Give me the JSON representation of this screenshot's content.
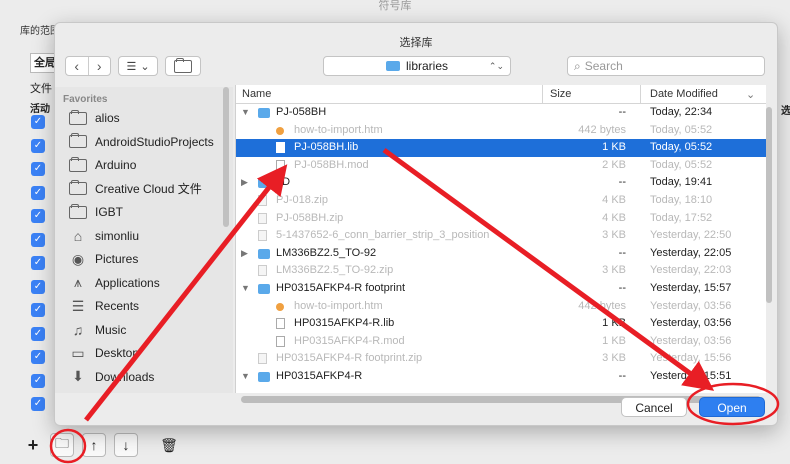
{
  "background": {
    "window_title": "符号库",
    "scope_label": "库的范围",
    "segment_label": "全局",
    "file_label": "文件",
    "active_header": "活动",
    "right_header": "选",
    "checkbox_glyph": "✓",
    "checked_rows": 13
  },
  "bottom_bar": {
    "add_glyph": "+",
    "folder_glyph": "🗀",
    "up_glyph": "↑",
    "down_glyph": "↓",
    "trash_glyph": "🗑"
  },
  "dialog": {
    "title": "选择库",
    "back_glyph": "‹",
    "forward_glyph": "›",
    "view_glyph": "☰",
    "view_caret": "⌄",
    "location": "libraries",
    "location_arrows": "⌃⌄",
    "search_placeholder": "Search",
    "cancel_label": "Cancel",
    "open_label": "Open"
  },
  "sidebar": {
    "header": "Favorites",
    "items": [
      {
        "label": "alios",
        "icon": "folder-icon"
      },
      {
        "label": "AndroidStudioProjects",
        "icon": "folder-icon"
      },
      {
        "label": "Arduino",
        "icon": "folder-icon"
      },
      {
        "label": "Creative Cloud 文件",
        "icon": "folder-icon"
      },
      {
        "label": "IGBT",
        "icon": "folder-icon"
      },
      {
        "label": "simonliu",
        "icon": "home-icon",
        "glyph": "⌂"
      },
      {
        "label": "Pictures",
        "icon": "camera-icon",
        "glyph": "◉"
      },
      {
        "label": "Applications",
        "icon": "applications-icon",
        "glyph": "⩚"
      },
      {
        "label": "Recents",
        "icon": "recents-icon",
        "glyph": "☰"
      },
      {
        "label": "Music",
        "icon": "music-icon",
        "glyph": "♫"
      },
      {
        "label": "Desktop",
        "icon": "desktop-icon",
        "glyph": "▭"
      },
      {
        "label": "Downloads",
        "icon": "downloads-icon",
        "glyph": "⬇"
      }
    ]
  },
  "file_list": {
    "columns": {
      "name": "Name",
      "size": "Size",
      "date": "Date Modified",
      "date_caret": "⌄"
    },
    "rows": [
      {
        "name": "PJ-058BH",
        "size": "--",
        "date": "Today, 22:34",
        "kind": "folder",
        "disc": "▼",
        "indent": 0,
        "state": "normal"
      },
      {
        "name": "how-to-import.htm",
        "size": "442 bytes",
        "date": "Today, 05:52",
        "kind": "web",
        "disc": "",
        "indent": 1,
        "state": "dim"
      },
      {
        "name": "PJ-058BH.lib",
        "size": "1 KB",
        "date": "Today, 05:52",
        "kind": "doc",
        "disc": "",
        "indent": 1,
        "state": "selected"
      },
      {
        "name": "PJ-058BH.mod",
        "size": "2 KB",
        "date": "Today, 05:52",
        "kind": "doc",
        "disc": "",
        "indent": 1,
        "state": "dim"
      },
      {
        "name": "3D",
        "size": "--",
        "date": "Today, 19:41",
        "kind": "folder",
        "disc": "▶",
        "indent": 0,
        "state": "normal"
      },
      {
        "name": "PJ-018.zip",
        "size": "4 KB",
        "date": "Today, 18:10",
        "kind": "zip",
        "disc": "",
        "indent": 0,
        "state": "dim"
      },
      {
        "name": "PJ-058BH.zip",
        "size": "4 KB",
        "date": "Today, 17:52",
        "kind": "zip",
        "disc": "",
        "indent": 0,
        "state": "dim"
      },
      {
        "name": "5-1437652-6_conn_barrier_strip_3_position",
        "size": "3 KB",
        "date": "Yesterday, 22:50",
        "kind": "zip",
        "disc": "",
        "indent": 0,
        "state": "dim"
      },
      {
        "name": "LM336BZ2.5_TO-92",
        "size": "--",
        "date": "Yesterday, 22:05",
        "kind": "folder",
        "disc": "▶",
        "indent": 0,
        "state": "normal"
      },
      {
        "name": "LM336BZ2.5_TO-92.zip",
        "size": "3 KB",
        "date": "Yesterday, 22:03",
        "kind": "zip",
        "disc": "",
        "indent": 0,
        "state": "dim"
      },
      {
        "name": "HP0315AFKP4-R footprint",
        "size": "--",
        "date": "Yesterday, 15:57",
        "kind": "folder",
        "disc": "▼",
        "indent": 0,
        "state": "normal"
      },
      {
        "name": "how-to-import.htm",
        "size": "442 bytes",
        "date": "Yesterday, 03:56",
        "kind": "web",
        "disc": "",
        "indent": 1,
        "state": "dim"
      },
      {
        "name": "HP0315AFKP4-R.lib",
        "size": "1 KB",
        "date": "Yesterday, 03:56",
        "kind": "doc",
        "disc": "",
        "indent": 1,
        "state": "normal"
      },
      {
        "name": "HP0315AFKP4-R.mod",
        "size": "1 KB",
        "date": "Yesterday, 03:56",
        "kind": "doc",
        "disc": "",
        "indent": 1,
        "state": "dim"
      },
      {
        "name": "HP0315AFKP4-R footprint.zip",
        "size": "3 KB",
        "date": "Yesterday, 15:56",
        "kind": "zip",
        "disc": "",
        "indent": 0,
        "state": "dim"
      },
      {
        "name": "HP0315AFKP4-R",
        "size": "--",
        "date": "Yesterday, 15:51",
        "kind": "folder",
        "disc": "▼",
        "indent": 0,
        "state": "normal"
      }
    ]
  },
  "colors": {
    "selection": "#1e6fd9",
    "open_button": "#2e7ff0",
    "annotation": "#e81e25",
    "folder": "#5aa9ea"
  }
}
